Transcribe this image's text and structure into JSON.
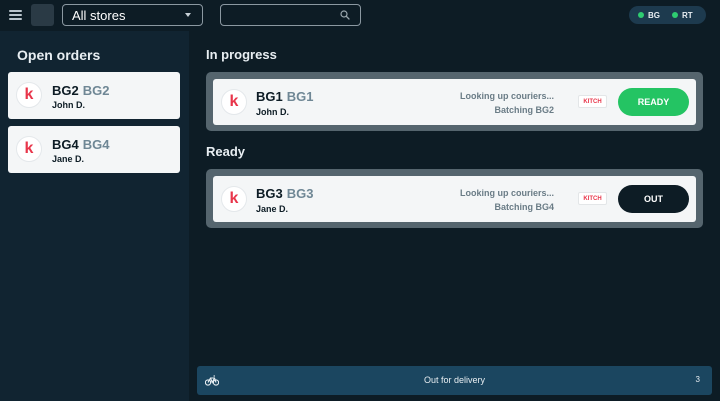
{
  "topbar": {
    "store_select": "All stores",
    "search_placeholder": "",
    "statuses": [
      {
        "code": "BG",
        "color": "#2ecc71"
      },
      {
        "code": "RT",
        "color": "#2ecc71"
      }
    ]
  },
  "sidebar": {
    "title": "Open orders",
    "orders": [
      {
        "avatar": "k",
        "id": "BG2",
        "sub": "BG2",
        "customer": "John D."
      },
      {
        "avatar": "k",
        "id": "BG4",
        "sub": "BG4",
        "customer": "Jane D."
      }
    ]
  },
  "in_progress": {
    "title": "In progress",
    "order": {
      "avatar": "k",
      "id": "BG1",
      "sub": "BG1",
      "customer": "John D.",
      "status_line1": "Looking up couriers...",
      "status_line2": "Batching BG2",
      "tag": "KITCH",
      "action": "READY"
    }
  },
  "ready": {
    "title": "Ready",
    "order": {
      "avatar": "k",
      "id": "BG3",
      "sub": "BG3",
      "customer": "Jane D.",
      "status_line1": "Looking up couriers...",
      "status_line2": "Batching BG4",
      "tag": "KITCH",
      "action": "OUT"
    }
  },
  "delivery": {
    "label": "Out for delivery",
    "count": "3"
  },
  "colors": {
    "background": "#0d1c25",
    "sidebar": "#112431",
    "accent_green": "#24c463",
    "brand_red": "#e8354a",
    "delivery_bar": "#1b4660"
  }
}
